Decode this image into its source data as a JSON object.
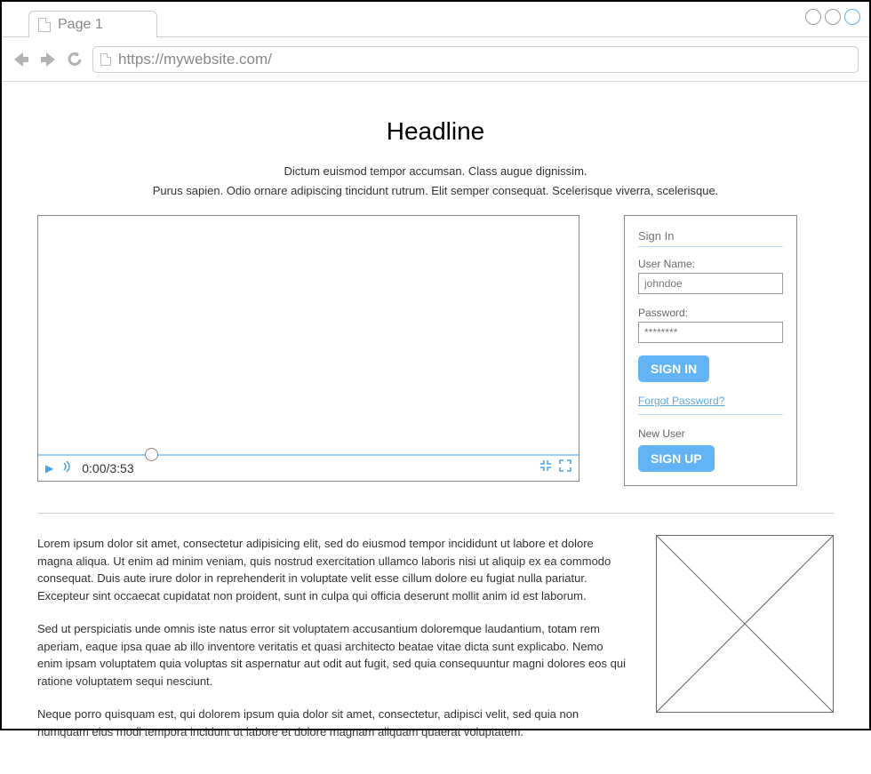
{
  "browser": {
    "tab_label": "Page 1",
    "url": "https://mywebsite.com/"
  },
  "page": {
    "headline": "Headline",
    "subhead_line1": "Dictum euismod tempor accumsan. Class augue dignissim.",
    "subhead_line2": "Purus sapien. Odio ornare adipiscing tincidunt rutrum.  Elit semper consequat. Scelerisque viverra, scelerisque."
  },
  "video": {
    "time": "0:00/3:53"
  },
  "signin": {
    "title": "Sign In",
    "username_label": "User Name:",
    "username_value": "johndoe",
    "password_label": "Password:",
    "password_value": "********",
    "signin_btn": "SIGN IN",
    "forgot": "Forgot Password?",
    "newuser_label": "New User",
    "signup_btn": "SIGN UP"
  },
  "body_text": {
    "p1": "Lorem ipsum dolor sit amet, consectetur adipisicing elit, sed do eiusmod tempor incididunt ut labore et dolore magna aliqua. Ut enim ad minim veniam, quis nostrud exercitation ullamco laboris nisi ut aliquip ex ea commodo consequat. Duis aute irure dolor in reprehenderit in voluptate velit esse cillum dolore eu fugiat nulla pariatur. Excepteur sint occaecat cupidatat non proident, sunt in culpa qui officia deserunt mollit anim id est laborum.",
    "p2": "Sed ut perspiciatis unde omnis iste natus error sit voluptatem accusantium doloremque laudantium, totam rem aperiam, eaque ipsa quae ab illo inventore veritatis et quasi architecto beatae vitae dicta sunt explicabo. Nemo enim ipsam voluptatem quia voluptas sit aspernatur aut odit aut fugit, sed quia consequuntur magni dolores eos qui ratione voluptatem sequi nesciunt.",
    "p3": "Neque porro quisquam est, qui dolorem ipsum quia dolor sit amet, consectetur, adipisci velit, sed quia non numquam eius modi tempora incidunt ut labore et dolore magnam aliquam quaerat voluptatem."
  }
}
